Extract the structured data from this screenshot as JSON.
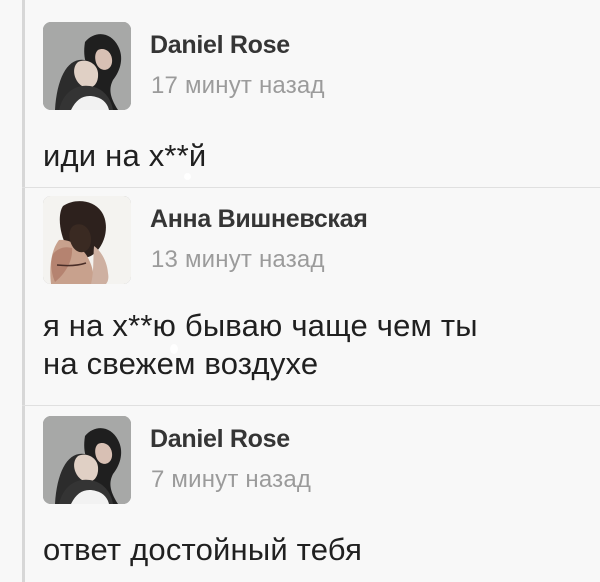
{
  "posts": [
    {
      "author": "Daniel Rose",
      "time": "17 минут назад",
      "message_lines": [
        "иди на х**й"
      ]
    },
    {
      "author": "Анна Вишневская",
      "time": "13 минут назад",
      "message_lines": [
        "я на х**ю бываю чаще чем ты",
        "на свежем воздухе"
      ]
    },
    {
      "author": "Daniel Rose",
      "time": "7 минут назад",
      "message_lines": [
        "ответ достойный тебя"
      ]
    }
  ],
  "colors": {
    "background": "#f8f8f8",
    "author_text": "#353535",
    "time_text": "#9b9b9b",
    "message_text": "#202020",
    "rule": "#d7d7d7"
  },
  "icons": {
    "post_1_avatar": "profile-photo-avatar",
    "post_2_avatar": "profile-photo-avatar",
    "post_3_avatar": "profile-photo-avatar"
  }
}
